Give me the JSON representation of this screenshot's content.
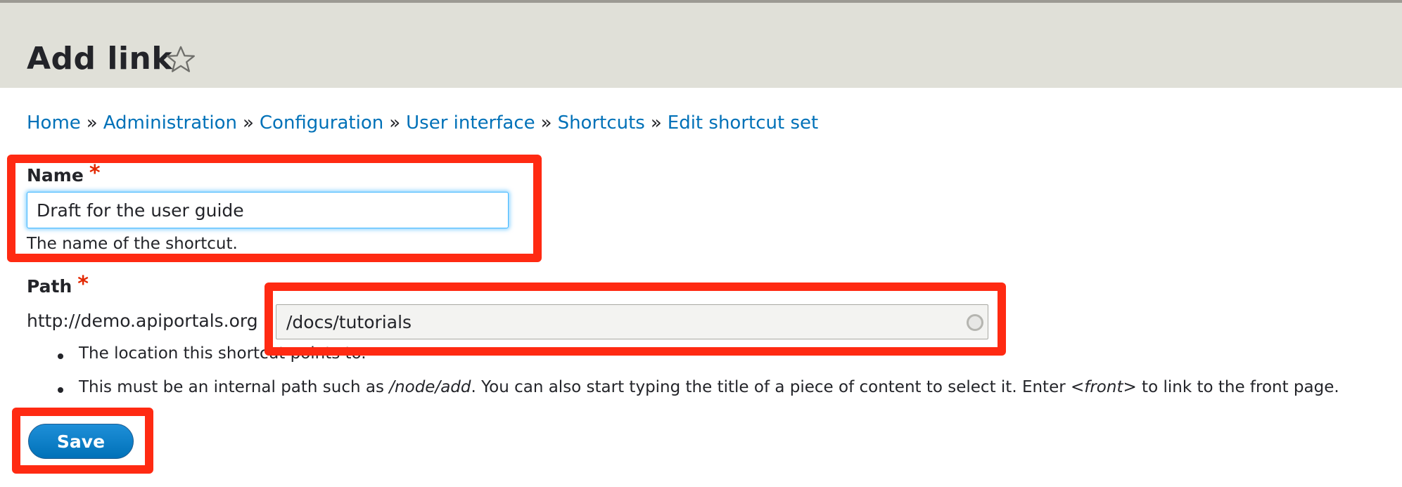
{
  "page": {
    "title": "Add link",
    "star_icon": "star-outline-icon"
  },
  "breadcrumb": {
    "separator": "»",
    "items": [
      "Home",
      "Administration",
      "Configuration",
      "User interface",
      "Shortcuts",
      "Edit shortcut set"
    ]
  },
  "form": {
    "name": {
      "label": "Name",
      "required_marker": "*",
      "value": "Draft for the user guide",
      "description": "The name of the shortcut."
    },
    "path": {
      "label": "Path",
      "required_marker": "*",
      "prefix": "http://demo.apiportals.org",
      "value": "/docs/tutorials",
      "autocomplete_icon": "throbber-icon",
      "help": {
        "item1": "The location this shortcut points to.",
        "item2_before": "This must be an internal path such as ",
        "item2_example": "/node/add",
        "item2_middle": ". You can also start typing the title of a piece of content to select it. Enter ",
        "item2_front": "<front>",
        "item2_after": " to link to the front page."
      }
    },
    "save_label": "Save"
  },
  "colors": {
    "header_bg": "#e0e0d8",
    "link": "#0071b8",
    "required": "#e32700",
    "button": "#0071b8",
    "highlight": "#ff2a12"
  }
}
